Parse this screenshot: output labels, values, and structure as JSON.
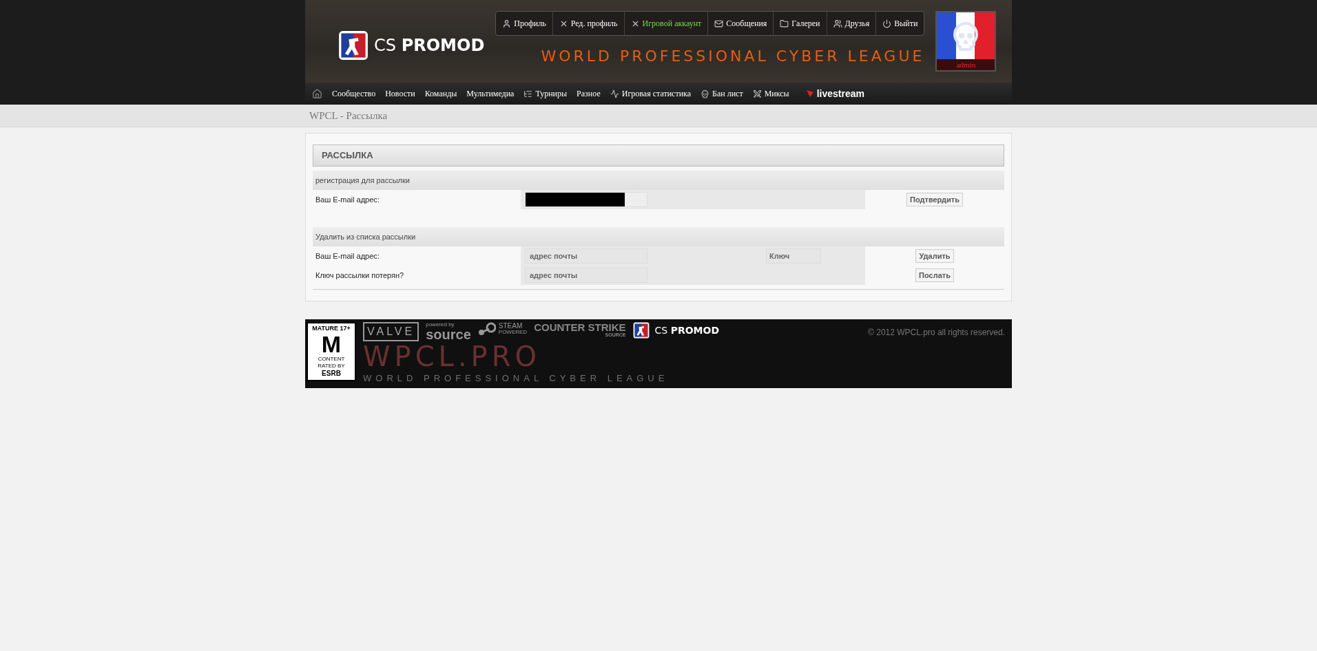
{
  "header": {
    "logo": {
      "prefix": "CS",
      "name": "PROMOD"
    },
    "tagline": "WORLD PROFESSIONAL CYBER LEAGUE",
    "user_menu": [
      {
        "label": "Профиль",
        "selected": false
      },
      {
        "label": "Ред. профиль",
        "selected": false
      },
      {
        "label": "Игровой аккаунт",
        "selected": true
      },
      {
        "label": "Сообщения",
        "selected": false
      },
      {
        "label": "Галереи",
        "selected": false
      },
      {
        "label": "Друзья",
        "selected": false
      },
      {
        "label": "Выйти",
        "selected": false
      }
    ],
    "avatar": {
      "username": "admin"
    }
  },
  "nav": [
    "Сообщество",
    "Новости",
    "Команды",
    "Мультимедиа",
    "Турниры",
    "Разное",
    "Игровая статистика",
    "Бан лист",
    "Миксы",
    "livestream"
  ],
  "breadcrumb": "WPCL - Рассылка",
  "panel": {
    "title": "РАССЫЛКА",
    "sections": [
      {
        "title": "регистрация для рассылки",
        "rows": [
          {
            "label": "Ваш E-mail адрес:",
            "email": {
              "redacted": true
            },
            "button": "Подтвердить"
          }
        ]
      },
      {
        "title": "Удалить из списка рассылки",
        "rows": [
          {
            "label": "Ваш E-mail адрес:",
            "email": {
              "redacted": false,
              "placeholder": "адрес почты"
            },
            "key": {
              "placeholder": "Ключ"
            },
            "button": "Удалить"
          },
          {
            "label": "Ключ рассылки потерян?",
            "email": {
              "redacted": false,
              "placeholder": "адрес почты"
            },
            "button": "Послать"
          }
        ]
      }
    ]
  },
  "footer": {
    "esrb": [
      "MATURE 17+",
      "M",
      "CONTENT RATED BY",
      "ESRB"
    ],
    "valve": "VALVE",
    "source": [
      "powered by",
      "source"
    ],
    "steam": [
      "STEAM",
      "POWERED"
    ],
    "css": [
      "COUNTER",
      "STRIKE",
      "SOURCE"
    ],
    "logo": {
      "prefix": "CS",
      "name": "PROMOD"
    },
    "bg_title": "WPCL.PRO",
    "bg_tagline": "WORLD PROFESSIONAL CYBER LEAGUE",
    "copyright": "© 2012 WPCL.pro all rights reserved."
  }
}
